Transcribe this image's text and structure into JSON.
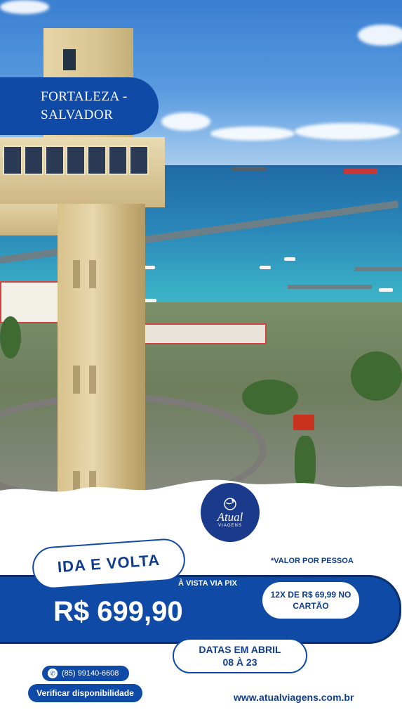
{
  "hero": {
    "title_line1": "FORTALEZA -",
    "title_line2": "SALVADOR"
  },
  "logo": {
    "brand": "Atual",
    "sub": "VIAGENS"
  },
  "offer": {
    "badge": "IDA E VOLTA",
    "per_person": "*VALOR POR PESSOA",
    "payment_note": "À VISTA VIA PIX",
    "price": "R$ 699,90",
    "installments_line1": "12X DE R$  69,99 NO",
    "installments_line2": "CARTÃO",
    "dates_line1": "DATAS EM ABRIL",
    "dates_line2": "08  À  23"
  },
  "contact": {
    "phone": "(85) 99140-6608",
    "cta": "Verificar disponibilidade",
    "website": "www.atualviagens.com.br"
  },
  "colors": {
    "primary": "#0f4aa6",
    "dark": "#0a2f6e",
    "white": "#ffffff"
  }
}
